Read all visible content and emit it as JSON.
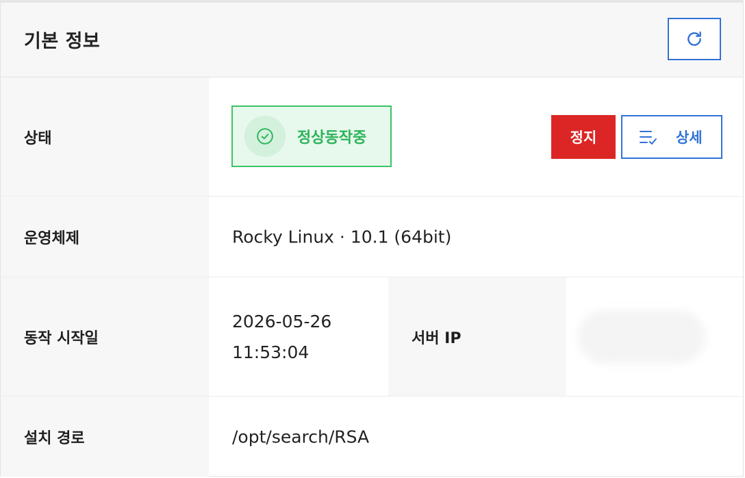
{
  "header": {
    "title": "기본 정보",
    "refresh_icon": "refresh-icon"
  },
  "rows": {
    "status": {
      "label": "상태",
      "badge_text": "정상동작중",
      "badge_icon": "check-circle-icon",
      "stop_label": "정지",
      "detail_label": "상세",
      "detail_icon": "list-check-icon"
    },
    "os": {
      "label": "운영체제",
      "value": "Rocky Linux · 10.1 (64bit)"
    },
    "start": {
      "label": "동작 시작일",
      "date": "2026-05-26",
      "time": "11:53:04",
      "server_ip_label": "서버 IP"
    },
    "install": {
      "label": "설치 경로",
      "value": "/opt/search/RSA"
    }
  },
  "colors": {
    "accent": "#2f72d6",
    "danger": "#dc2626",
    "success": "#2db35a",
    "success_bg": "#e7f8ec"
  }
}
